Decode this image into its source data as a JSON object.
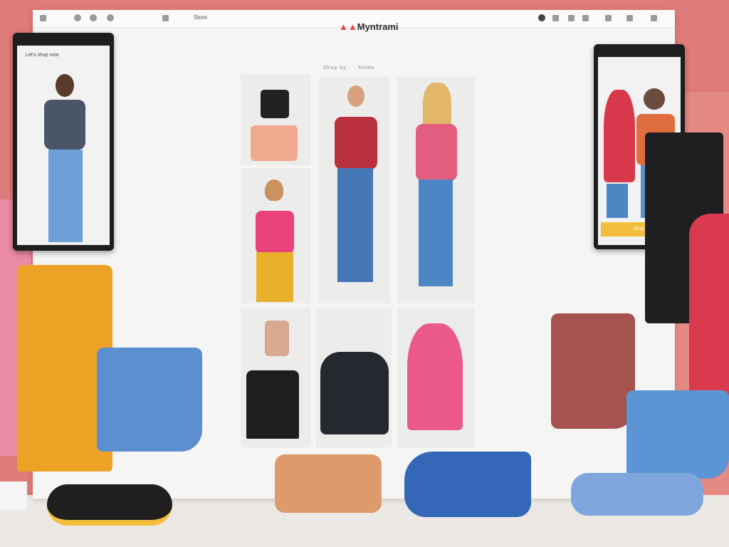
{
  "site": {
    "logo_text": "Myntrami",
    "nav": [
      "Shop by",
      "Home"
    ]
  },
  "browser": {
    "toolbar_text": "Store",
    "toolbar_icons": [
      "back-icon",
      "forward-icon",
      "refresh-icon",
      "home-icon",
      "tab-icon",
      "profile-icon",
      "bookmark-icon",
      "menu-icon"
    ]
  },
  "phone_left": {
    "header_text": "Let's shop now"
  },
  "phone_right": {
    "button_label": "Shop"
  },
  "colors": {
    "background_pink": "#df7b78",
    "panel_blue": "#3f83d0",
    "accent_yellow": "#f2be3c",
    "logo_red": "#e0493f"
  }
}
